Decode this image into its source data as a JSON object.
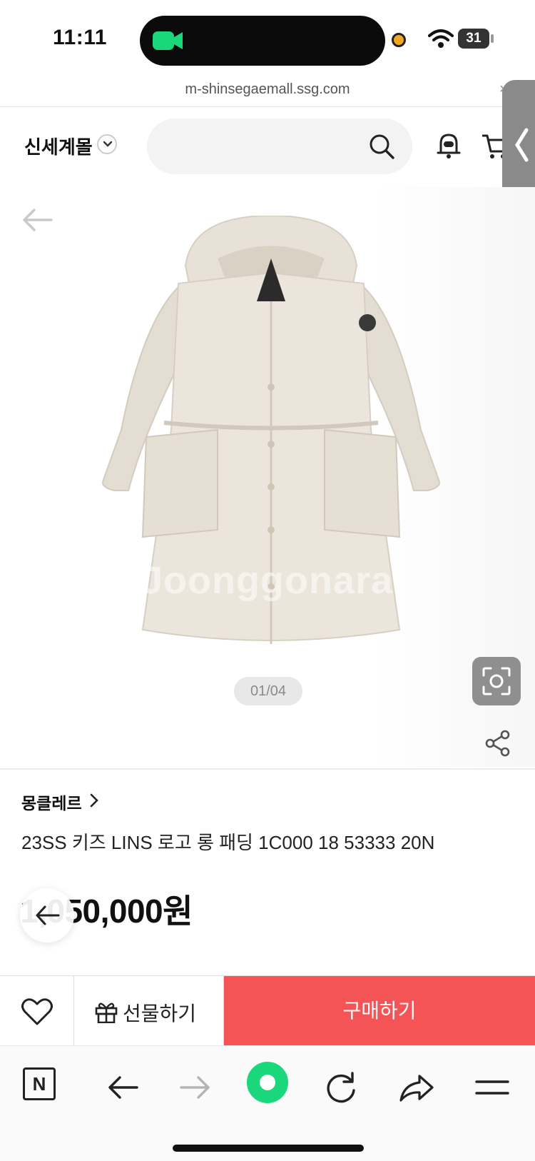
{
  "status_bar": {
    "time": "11:11",
    "battery": "31"
  },
  "url_bar": {
    "url": "m-shinsegaemall.ssg.com"
  },
  "header": {
    "brand": "신세계몰",
    "search_placeholder": ""
  },
  "gallery": {
    "watermark": "Joonggonara",
    "page_indicator": "01/04"
  },
  "product": {
    "brand": "몽클레르",
    "title": "23SS 키즈 LINS 로고 롱 패딩 1C000 18 53333 20N",
    "price": "1,050,000원"
  },
  "action_bar": {
    "gift_label": "선물하기",
    "buy_label": "구매하기"
  },
  "icons": {
    "camera": "video-camera-icon",
    "wifi": "wifi-icon",
    "search": "search-icon",
    "bell": "bell-icon",
    "cart": "cart-icon",
    "back": "back-arrow-icon",
    "lens": "lens-icon",
    "share": "share-icon",
    "heart": "heart-icon",
    "gift": "gift-icon"
  },
  "colors": {
    "buy_button": "#f45456",
    "camera_indicator": "#19d77a",
    "green_button": "#19d77a",
    "orange_dot": "#f5a524"
  }
}
